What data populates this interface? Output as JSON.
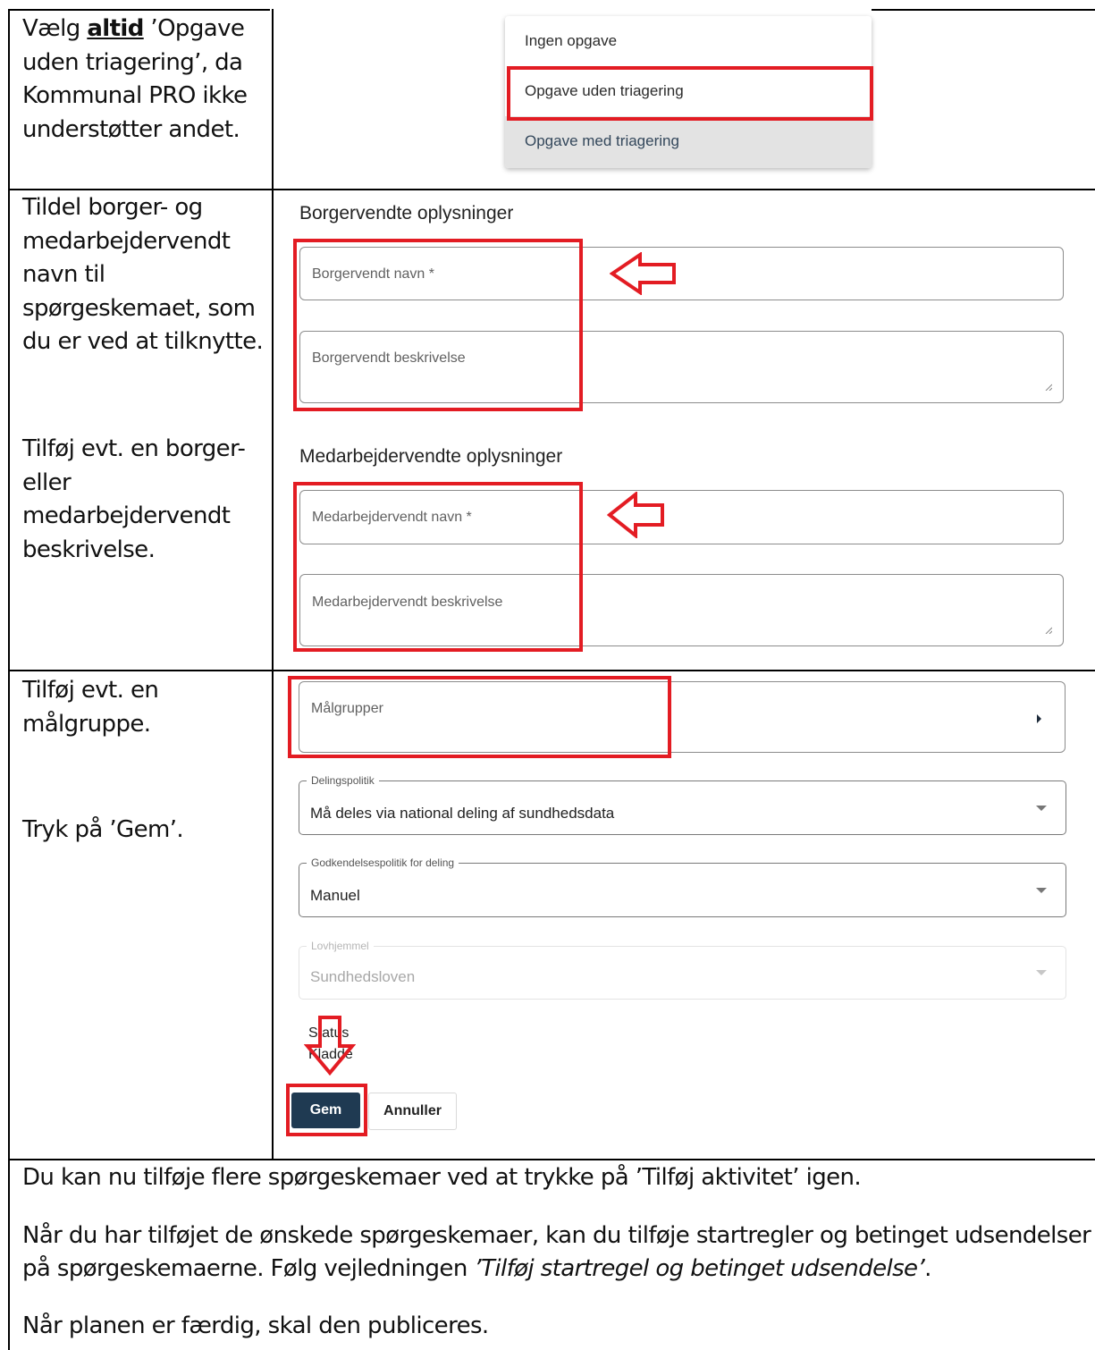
{
  "row1": {
    "instruction": {
      "prefix": "Vælg ",
      "bold": "altid",
      "suffix": " ’Opgave uden triagering’, da Kommunal PRO ikke understøtter andet."
    },
    "dropdown_menu": {
      "items": [
        "Ingen opgave",
        "Opgave uden triagering",
        "Opgave med triagering"
      ]
    }
  },
  "row2": {
    "instruction_1": "Tildel borger- og medarbejdervendt navn til spørgeskemaet, som du er ved at tilknytte.",
    "instruction_2": "Tilføj evt. en borger- eller medarbejdervendt beskrivelse.",
    "citizen_section": {
      "title": "Borgervendte oplysninger",
      "name_placeholder": "Borgervendt navn *",
      "description_placeholder": "Borgervendt beskrivelse"
    },
    "staff_section": {
      "title": "Medarbejdervendte oplysninger",
      "name_placeholder": "Medarbejdervendt navn *",
      "description_placeholder": "Medarbejdervendt beskrivelse"
    }
  },
  "row3": {
    "instruction_1": "Tilføj evt. en målgruppe.",
    "instruction_2": "Tryk på ’Gem’.",
    "target_groups_label": "Målgrupper",
    "sharing_policy": {
      "label": "Delingspolitik",
      "value": "Må deles via national deling af sundhedsdata"
    },
    "approval_policy": {
      "label": "Godkendelsespolitik for deling",
      "value": "Manuel"
    },
    "legal_basis": {
      "label": "Lovhjemmel",
      "value": "Sundhedsloven"
    },
    "status": {
      "label": "Status",
      "value": "Kladde"
    },
    "save_label": "Gem",
    "cancel_label": "Annuller"
  },
  "row4": {
    "paragraph_1": "Du kan nu tilføje flere spørgeskemaer ved at trykke på ’Tilføj aktivitet’ igen.",
    "paragraph_2_line_1": "Når du har tilføjet de ønskede spørgeskemaer, kan du tilføje startregler og betinget udsendelser",
    "paragraph_2_line_2_prefix": "på spørgeskemaerne. Følg vejledningen ",
    "paragraph_2_italic": "’Tilføj startregel og betinget udsendelse’",
    "paragraph_2_suffix": ".",
    "paragraph_3": "Når planen er færdig, skal den publiceres."
  },
  "colors": {
    "highlight_red": "#e31c23",
    "primary_button": "#1f3a52",
    "border": "#000000"
  }
}
